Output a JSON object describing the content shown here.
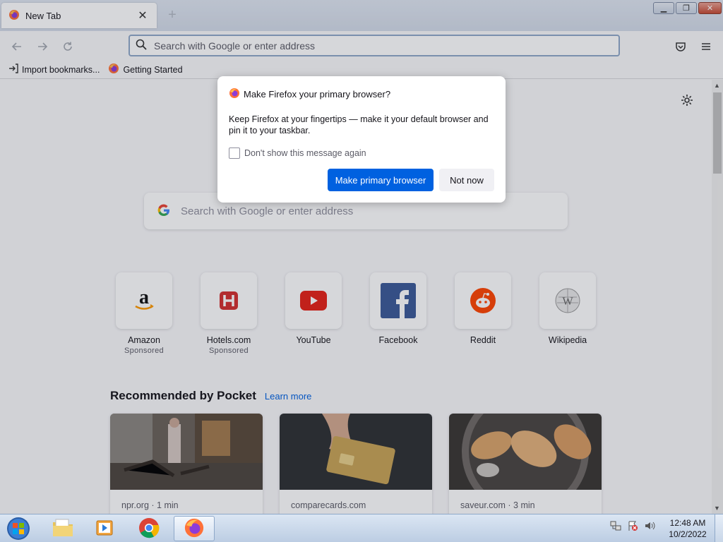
{
  "browser": {
    "tab": {
      "title": "New Tab",
      "close_icon": "close-icon"
    },
    "urlbar": {
      "placeholder": "Search with Google or enter address"
    }
  },
  "bookmarks": [
    {
      "label": "Import bookmarks...",
      "icon": "import-icon"
    },
    {
      "label": "Getting Started",
      "icon": "firefox-icon"
    }
  ],
  "newtab": {
    "search_placeholder": "Search with Google or enter address",
    "top_sites": [
      {
        "name": "Amazon",
        "sponsored": "Sponsored"
      },
      {
        "name": "Hotels.com",
        "sponsored": "Sponsored"
      },
      {
        "name": "YouTube",
        "sponsored": ""
      },
      {
        "name": "Facebook",
        "sponsored": ""
      },
      {
        "name": "Reddit",
        "sponsored": ""
      },
      {
        "name": "Wikipedia",
        "sponsored": ""
      }
    ],
    "pocket": {
      "heading": "Recommended by Pocket",
      "learn_more": "Learn more",
      "cards": [
        {
          "source": "npr.org · 1 min"
        },
        {
          "source": "comparecards.com"
        },
        {
          "source": "saveur.com · 3 min"
        }
      ]
    }
  },
  "dialog": {
    "title": "Make Firefox your primary browser?",
    "body": "Keep Firefox at your fingertips — make it your default browser and pin it to your taskbar.",
    "checkbox_label": "Don't show this message again",
    "primary_button": "Make primary browser",
    "secondary_button": "Not now"
  },
  "taskbar": {
    "time": "12:48 AM",
    "date": "10/2/2022"
  },
  "colors": {
    "accent": "#0061e0",
    "google_blue": "#4285f4",
    "youtube_red": "#e62117",
    "facebook_blue": "#3b5998",
    "reddit_orange": "#ff4500"
  }
}
